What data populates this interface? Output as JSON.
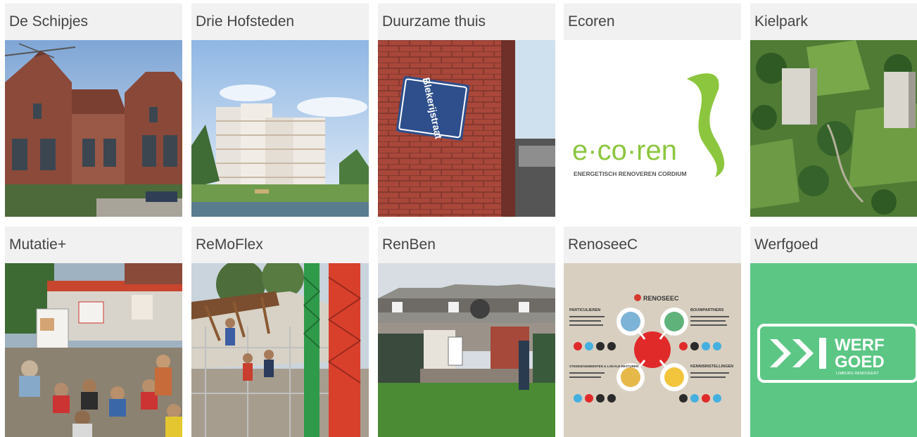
{
  "projects": [
    {
      "title": "De Schipjes"
    },
    {
      "title": "Drie Hofsteden"
    },
    {
      "title": "Duurzame thuis",
      "sign_text": "Blekerijstraat"
    },
    {
      "title": "Ecoren",
      "logo_text": "e·co·ren",
      "logo_tagline": "ENERGETISCH RENOVEREN CORDIUM"
    },
    {
      "title": "Kielpark"
    },
    {
      "title": "Mutatie+"
    },
    {
      "title": "ReMoFlex"
    },
    {
      "title": "RenBen"
    },
    {
      "title": "RenoseeC",
      "logo_text": "RENOSEEC",
      "labels": [
        "PARTICULIEREN",
        "BOUWPARTNERS",
        "STEDEN/GEMEENTEN & LOKALE BESTUREN",
        "KENNISINSTELLINGEN"
      ]
    },
    {
      "title": "Werfgoed",
      "logo_line1": "WERF",
      "logo_line2": "GOED",
      "logo_tagline": "LIMBURG RENOVEERT"
    }
  ],
  "colors": {
    "title_bar_bg": "#f1f1f1",
    "title_text": "#444444",
    "ecoren_green": "#8cc63f",
    "werfgoed_green": "#5cc685",
    "renoseec_bg": "#d8cfc0"
  }
}
